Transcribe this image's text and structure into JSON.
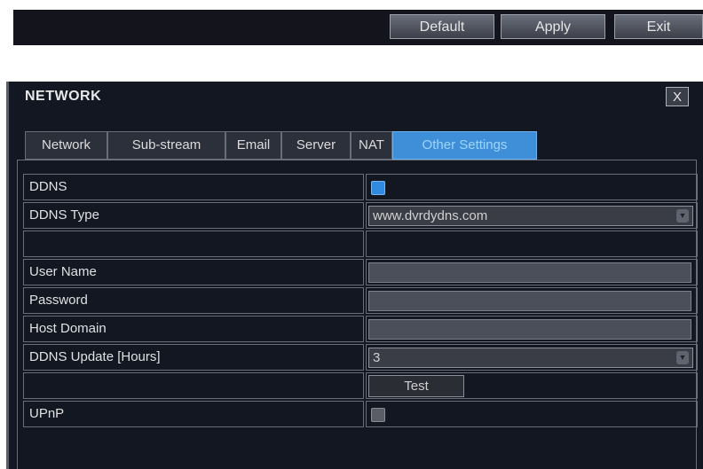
{
  "toolbar": {
    "default_label": "Default",
    "apply_label": "Apply",
    "exit_label": "Exit"
  },
  "dialog": {
    "title": "NETWORK",
    "close_label": "X"
  },
  "tabs": [
    {
      "label": "Network",
      "active": false
    },
    {
      "label": "Sub-stream",
      "active": false
    },
    {
      "label": "Email",
      "active": false
    },
    {
      "label": "Server",
      "active": false
    },
    {
      "label": "NAT",
      "active": false
    },
    {
      "label": "Other Settings",
      "active": true
    }
  ],
  "form": {
    "ddns_label": "DDNS",
    "ddns_checked": true,
    "ddns_type_label": "DDNS Type",
    "ddns_type_value": "www.dvrdydns.com",
    "user_name_label": "User Name",
    "user_name_value": "",
    "password_label": "Password",
    "password_value": "",
    "host_domain_label": "Host Domain",
    "host_domain_value": "",
    "ddns_update_label": "DDNS Update [Hours]",
    "ddns_update_value": "3",
    "test_label": "Test",
    "upnp_label": "UPnP",
    "upnp_checked": false
  },
  "colors": {
    "accent": "#3f8fd8",
    "panel_bg": "#121722"
  }
}
